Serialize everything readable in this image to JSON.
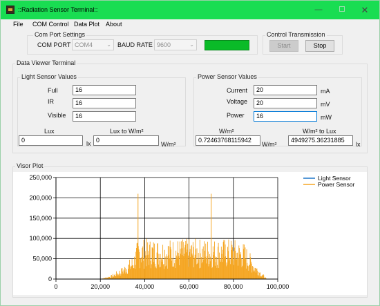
{
  "window": {
    "title": "::Radiation Sensor Terminal::",
    "accent": "#19dd52",
    "controls": {
      "minimize": "—",
      "close": "✕"
    }
  },
  "menu": [
    "File",
    "COM Control",
    "Data Plot",
    "About"
  ],
  "com_port_settings": {
    "title": "Com Port Settings",
    "port_label": "COM PORT",
    "port_value": "COM4",
    "baud_label": "BAUD RATE",
    "baud_value": "9600",
    "status_color": "#0abb28"
  },
  "control_transmission": {
    "title": "Control Transmission",
    "start_label": "Start",
    "stop_label": "Stop"
  },
  "data_viewer": {
    "title": "Data Viewer Terminal",
    "light": {
      "title": "Light Sensor Values",
      "full_label": "Full",
      "full_value": "16",
      "ir_label": "IR",
      "ir_value": "16",
      "visible_label": "Visible",
      "visible_value": "16",
      "lux_label": "Lux",
      "lux_value": "0",
      "lux_unit": "lx",
      "lux_to_w_label": "Lux to W/m²",
      "lux_to_w_value": "0",
      "lux_to_w_unit": "W/m²"
    },
    "power": {
      "title": "Power Sensor Values",
      "current_label": "Current",
      "current_value": "20",
      "current_unit": "mA",
      "voltage_label": "Voltage",
      "voltage_value": "20",
      "voltage_unit": "mV",
      "power_label": "Power",
      "power_value": "16",
      "power_unit": "mW",
      "wm2_label": "W/m²",
      "wm2_value": "0.72463768115942",
      "wm2_unit": "W/m²",
      "wm2_to_lux_label": "W/m² to Lux",
      "wm2_to_lux_value": "4949275.36231885",
      "wm2_to_lux_unit": "lx"
    }
  },
  "visor_plot": {
    "title": "Visor Plot"
  },
  "chart_data": {
    "type": "line",
    "xlim": [
      0,
      100000
    ],
    "ylim": [
      0,
      250000
    ],
    "x_ticks": [
      "0",
      "20,000",
      "40,000",
      "60,000",
      "80,000",
      "100,000"
    ],
    "y_ticks": [
      "0",
      "50,000",
      "100,000",
      "150,000",
      "200,000",
      "250,000"
    ],
    "grid": true,
    "legend_position": "top-right",
    "series": [
      {
        "name": "Light Sensor",
        "color": "#1f77c8",
        "values": []
      },
      {
        "name": "Power Sensor",
        "color": "#f5a623",
        "x": [
          20000,
          25000,
          30000,
          35000,
          37000,
          38000,
          40000,
          45000,
          50000,
          55000,
          60000,
          65000,
          70000,
          75000,
          80000,
          85000,
          90000,
          95000
        ],
        "values": [
          0,
          10000,
          30000,
          60000,
          210000,
          100000,
          100000,
          100000,
          100000,
          100000,
          100000,
          100000,
          210000,
          100000,
          100000,
          90000,
          40000,
          0
        ]
      }
    ]
  }
}
